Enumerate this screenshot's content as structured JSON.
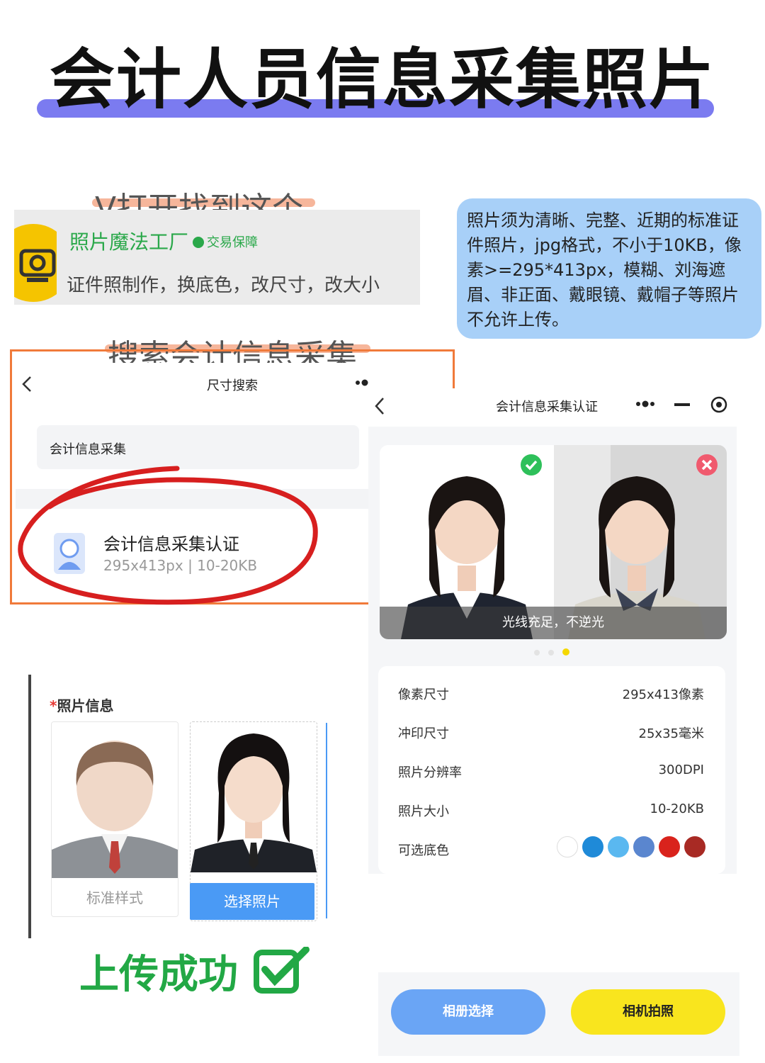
{
  "title": "会计人员信息采集照片",
  "step1": {
    "label": "V打开找到这个"
  },
  "mini_program": {
    "name": "照片魔法工厂",
    "badge": "交易保障",
    "desc": "证件照制作，换底色，改尺寸，改大小"
  },
  "note": "照片须为清晰、完整、近期的标准证件照片，jpg格式，不小于10KB，像素>=295*413px，模糊、刘海遮眉、非正面、戴眼镜、戴帽子等照片不允许上传。",
  "step2": {
    "label": "搜索会计信息采集"
  },
  "search_screen": {
    "nav_title": "尺寸搜索",
    "query": "会计信息采集",
    "result_title": "会计信息采集认证",
    "result_sub": "295x413px | 10-20KB"
  },
  "auth_screen": {
    "nav_title": "会计信息采集认证",
    "caption": "光线充足，不逆光",
    "info": [
      {
        "label": "像素尺寸",
        "value": "295x413像素"
      },
      {
        "label": "冲印尺寸",
        "value": "25x35毫米"
      },
      {
        "label": "照片分辨率",
        "value": "300DPI"
      },
      {
        "label": "照片大小",
        "value": "10-20KB"
      },
      {
        "label": "可选底色",
        "value": ""
      }
    ],
    "bg_colors": [
      "#ffffff",
      "#1f8ad8",
      "#5ab8f0",
      "#5a86cf",
      "#d9231c",
      "#a82a24"
    ],
    "btn_album": "相册选择",
    "btn_camera": "相机拍照"
  },
  "upload": {
    "star": "*",
    "title": "照片信息",
    "sample_label": "标准样式",
    "choose_label": "选择照片",
    "success": "上传成功"
  },
  "colors": {
    "accent_green": "#22a845",
    "accent_blue": "#4a9af5",
    "accent_yellow": "#f9e51e",
    "orange": "#f07a3a"
  }
}
